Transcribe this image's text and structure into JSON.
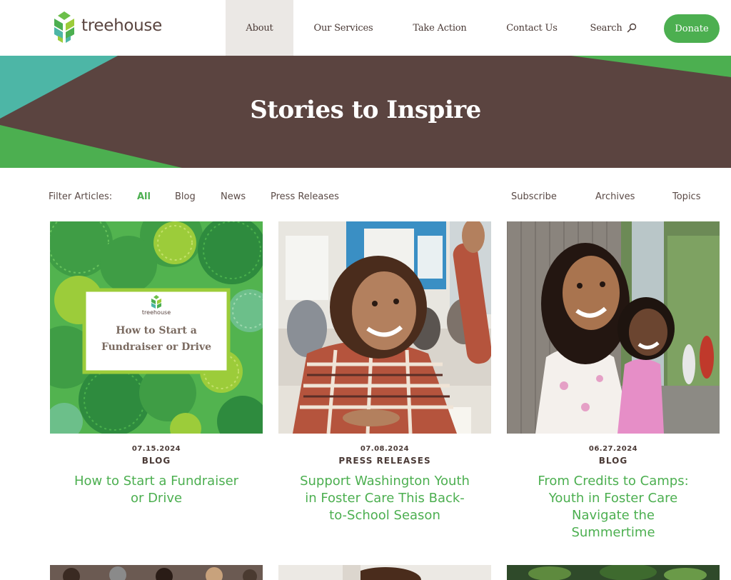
{
  "brand": {
    "name": "treehouse"
  },
  "nav": {
    "about": "About",
    "services": "Our Services",
    "action": "Take Action",
    "contact": "Contact Us",
    "search": "Search",
    "donate": "Donate"
  },
  "hero": {
    "title": "Stories to Inspire"
  },
  "filter": {
    "label": "Filter Articles:",
    "all": "All",
    "blog": "Blog",
    "news": "News",
    "press": "Press Releases",
    "subscribe": "Subscribe",
    "archives": "Archives",
    "topics": "Topics"
  },
  "cards": [
    {
      "image_title_line1": "How to Start a",
      "image_title_line2": "Fundraiser or Drive",
      "image_brand": "treehouse",
      "date": "07.15.2024",
      "category": "BLOG",
      "title": "How to Start a Fundraiser or Drive"
    },
    {
      "date": "07.08.2024",
      "category": "PRESS RELEASES",
      "title": "Support Washington Youth in Foster Care This Back-to-School Season"
    },
    {
      "date": "06.27.2024",
      "category": "BLOG",
      "title": "From Credits to Camps: Youth in Foster Care Navigate the Summertime"
    }
  ],
  "colors": {
    "brand_green": "#4caf50",
    "hero_brown": "#5b4440",
    "teal": "#4db6a6",
    "text_brown": "#4a3a36",
    "nav_active_bg": "#ebe8e5"
  }
}
